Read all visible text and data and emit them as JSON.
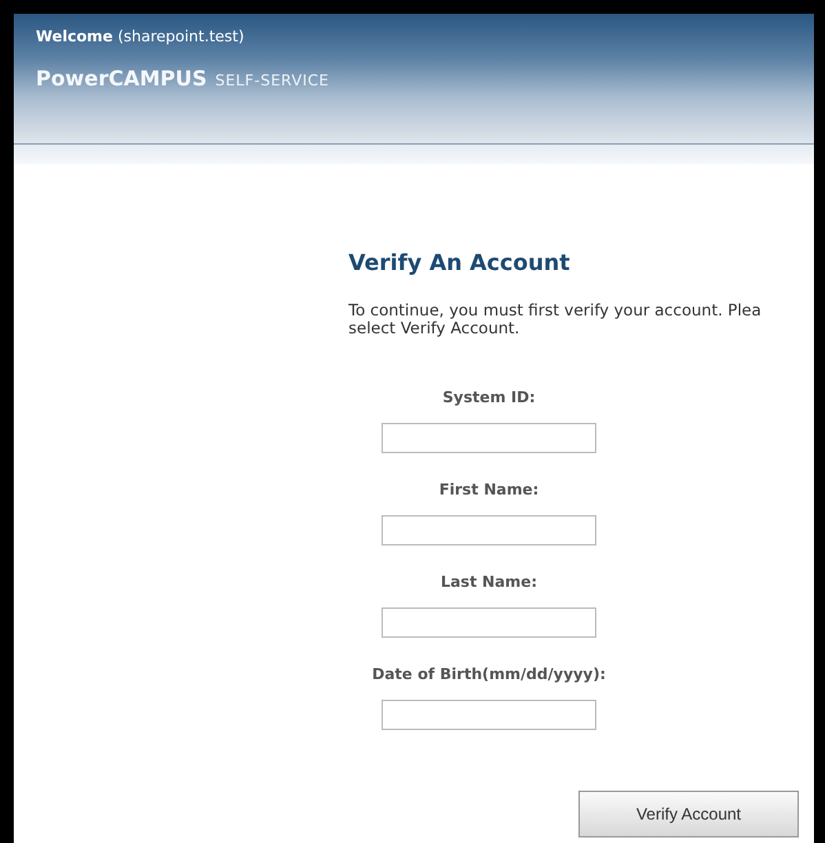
{
  "header": {
    "welcome": "**Welcome** (sharepoint.test)",
    "product": "PowerCAMPUS",
    "product_suffix": "SELF-SERVICE"
  },
  "page": {
    "title": "Verify An Account",
    "lines": [
      "To continue, you must first verify your account. Plea",
      "select Verify Account."
    ]
  },
  "fields": [
    {
      "label": "System ID:"
    },
    {
      "label": "First Name:"
    },
    {
      "label": "Last Name:"
    },
    {
      "label": "Date of Birth(mm/dd/yyyy):"
    }
  ],
  "buttons": [
    "Verify Account"
  ]
}
